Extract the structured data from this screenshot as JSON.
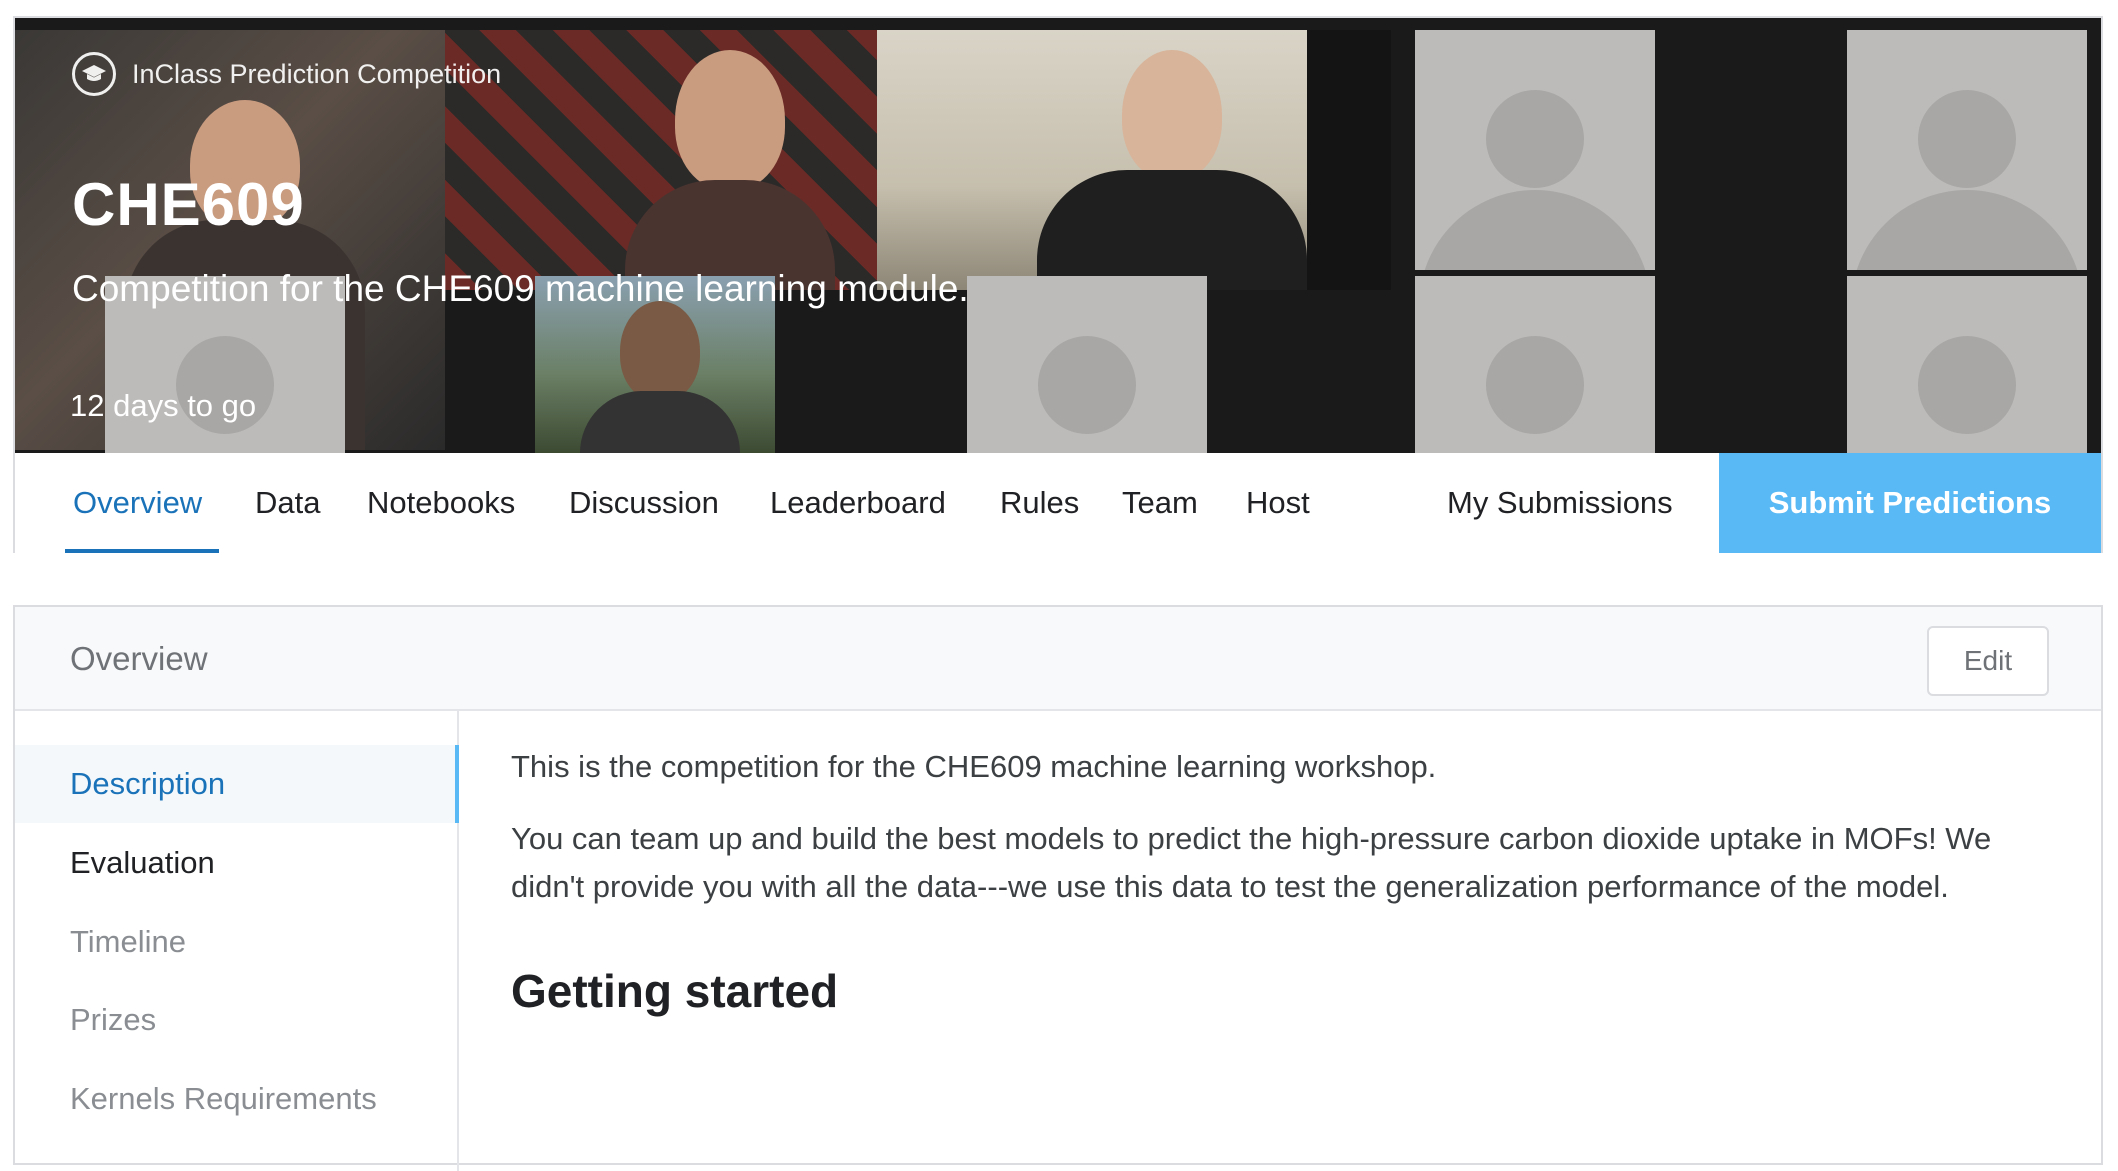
{
  "banner": {
    "competition_type": "InClass Prediction Competition",
    "title": "CHE609",
    "subtitle": "Competition for the CHE609 machine learning module.",
    "deadline": "12 days to go"
  },
  "nav": {
    "items": [
      "Overview",
      "Data",
      "Notebooks",
      "Discussion",
      "Leaderboard",
      "Rules",
      "Team",
      "Host"
    ],
    "my_submissions": "My Submissions",
    "submit": "Submit Predictions",
    "active_index": 0
  },
  "overview": {
    "title": "Overview",
    "edit": "Edit",
    "sidebar": [
      "Description",
      "Evaluation",
      "Timeline",
      "Prizes",
      "Kernels Requirements"
    ],
    "active_sidebar_index": 0,
    "content": {
      "p1": "This is the competition for the CHE609 machine learning workshop.",
      "p2": "You can team up and build the best models to predict the high-pressure carbon dioxide uptake in MOFs! We didn't provide you with all the data---we use this data to test the generalization performance of the model.",
      "heading": "Getting started"
    }
  },
  "colors": {
    "accent": "#1a73b8",
    "submit_bg": "#58b9f5",
    "placeholder_tile": "#bdbbba"
  }
}
